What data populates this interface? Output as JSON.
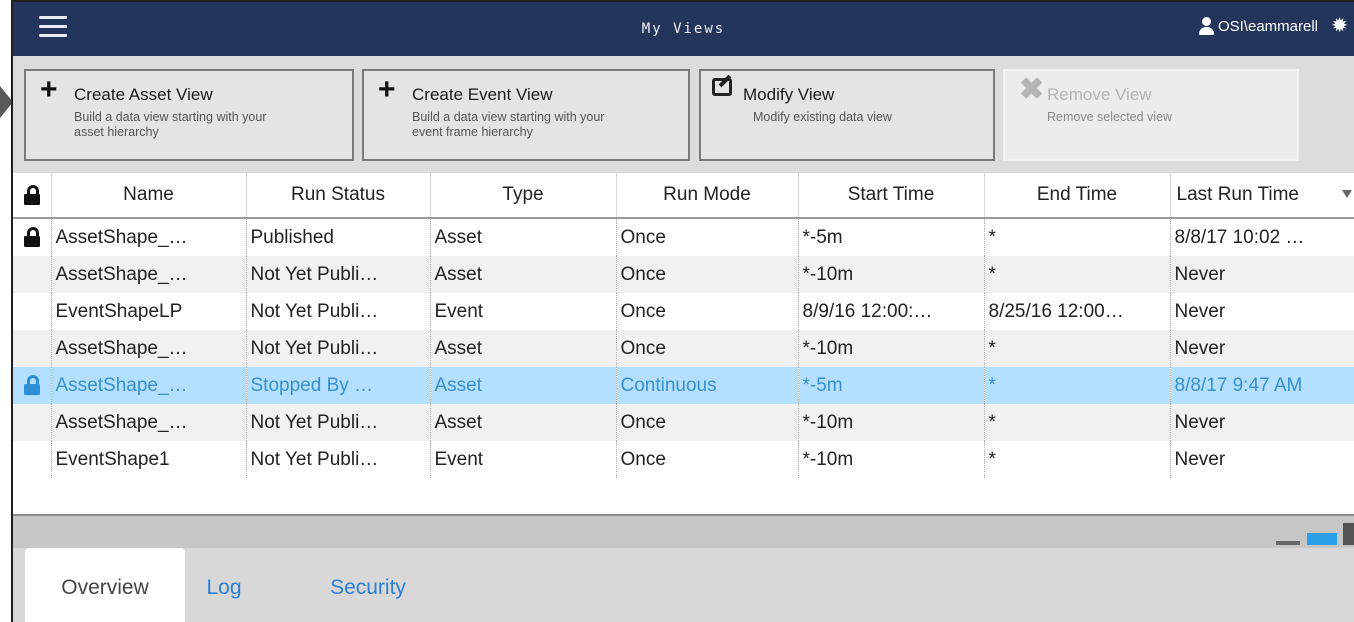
{
  "header": {
    "title": "My Views",
    "user": "OSI\\eammarell"
  },
  "toolbar": {
    "create_asset": {
      "label": "Create Asset View",
      "desc1": "Build a data view starting with your",
      "desc2": "asset hierarchy"
    },
    "create_event": {
      "label": "Create Event View",
      "desc1": "Build a data view starting with your",
      "desc2": "event frame hierarchy"
    },
    "modify": {
      "label": "Modify View",
      "desc1": "Modify existing data view"
    },
    "remove": {
      "label": "Remove View",
      "desc1": "Remove selected view"
    }
  },
  "table": {
    "columns": [
      "Name",
      "Run Status",
      "Type",
      "Run Mode",
      "Start Time",
      "End Time",
      "Last Run Time"
    ],
    "rows": [
      {
        "locked": true,
        "cells": [
          "AssetShape_…",
          "Published",
          "Asset",
          "Once",
          "*-5m",
          "*",
          "8/8/17 10:02 …"
        ]
      },
      {
        "locked": false,
        "cells": [
          "AssetShape_…",
          "Not Yet Publi…",
          "Asset",
          "Once",
          "*-10m",
          "*",
          "Never"
        ]
      },
      {
        "locked": false,
        "cells": [
          "EventShapeLP",
          "Not Yet Publi…",
          "Event",
          "Once",
          "8/9/16 12:00:…",
          "8/25/16 12:00…",
          "Never"
        ]
      },
      {
        "locked": false,
        "cells": [
          "AssetShape_…",
          "Not Yet Publi…",
          "Asset",
          "Once",
          "*-10m",
          "*",
          "Never"
        ]
      },
      {
        "locked": true,
        "selected": true,
        "cells": [
          "AssetShape_…",
          "Stopped By …",
          "Asset",
          "Continuous",
          "*-5m",
          "*",
          "8/8/17 9:47 AM"
        ]
      },
      {
        "locked": false,
        "cells": [
          "AssetShape_…",
          "Not Yet Publi…",
          "Asset",
          "Once",
          "*-10m",
          "*",
          "Never"
        ]
      },
      {
        "locked": false,
        "cells": [
          "EventShape1",
          "Not Yet Publi…",
          "Event",
          "Once",
          "*-10m",
          "*",
          "Never"
        ]
      }
    ]
  },
  "tabs": [
    "Overview",
    "Log",
    "Security"
  ],
  "colors": {
    "header_bg": "#23355a",
    "selected_row": "#b3e0ff",
    "accent": "#2b7fd4"
  }
}
